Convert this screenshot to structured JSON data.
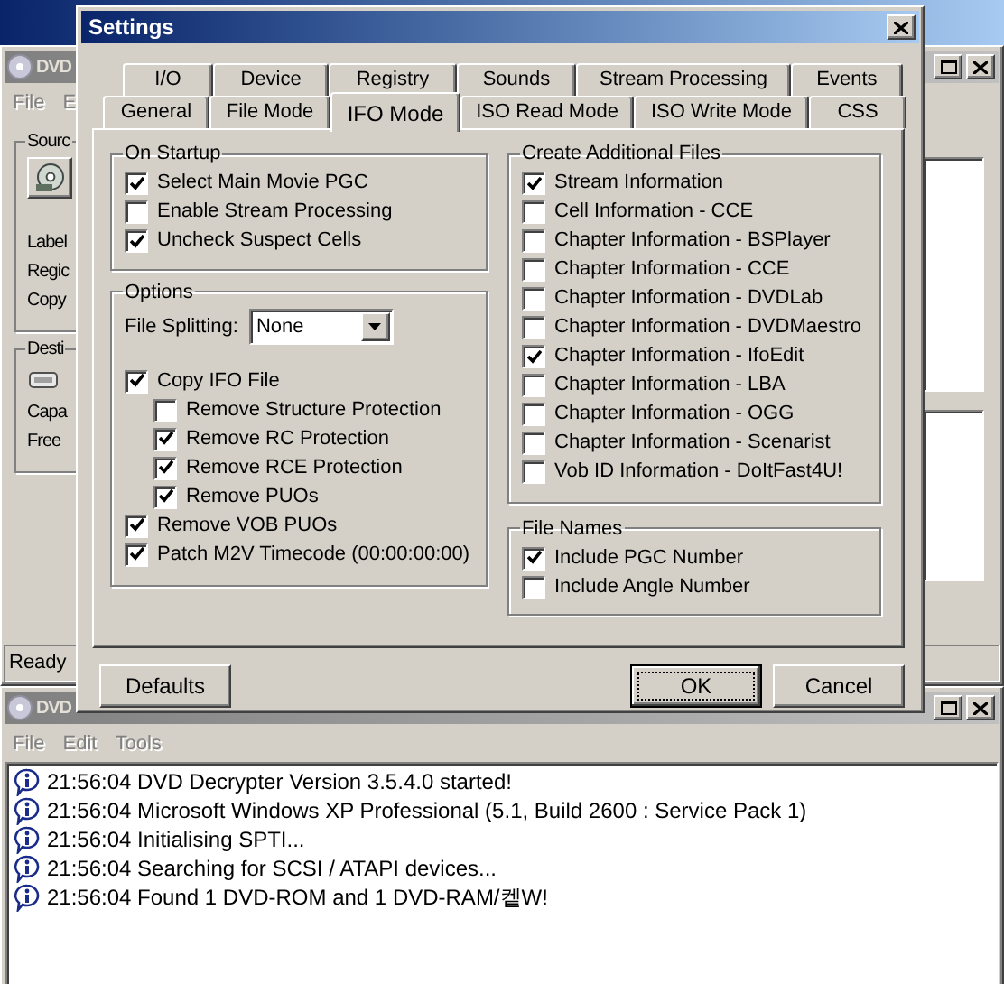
{
  "main_window": {
    "title": "DVD",
    "menu": [
      "File",
      "E"
    ],
    "source_group": {
      "title": "Sourc",
      "rows": [
        "Label",
        "Regic",
        "Copy"
      ]
    },
    "destination_group": {
      "title": "Desti",
      "rows": [
        "Capa",
        "Free"
      ]
    },
    "status_bar": "Ready"
  },
  "log_window": {
    "title": "DVD",
    "menu": [
      "File",
      "Edit",
      "Tools"
    ],
    "entries": [
      "21:56:04 DVD Decrypter Version 3.5.4.0 started!",
      "21:56:04 Microsoft Windows XP Professional (5.1, Build 2600 : Service Pack 1)",
      "21:56:04 Initialising SPTI...",
      "21:56:04 Searching for SCSI / ATAPI devices...",
      "21:56:04 Found 1 DVD-ROM and 1 DVD-RAM/켙W!"
    ]
  },
  "settings": {
    "title": "Settings",
    "tab_rows": [
      [
        {
          "label": "I/O",
          "selected": false
        },
        {
          "label": "Device",
          "selected": false
        },
        {
          "label": "Registry",
          "selected": false
        },
        {
          "label": "Sounds",
          "selected": false
        },
        {
          "label": "Stream Processing",
          "selected": false
        },
        {
          "label": "Events",
          "selected": false
        }
      ],
      [
        {
          "label": "General",
          "selected": false
        },
        {
          "label": "File Mode",
          "selected": false
        },
        {
          "label": "IFO Mode",
          "selected": true
        },
        {
          "label": "ISO Read Mode",
          "selected": false
        },
        {
          "label": "ISO Write Mode",
          "selected": false
        },
        {
          "label": "CSS",
          "selected": false
        }
      ]
    ],
    "on_startup": {
      "title": "On Startup",
      "options": [
        {
          "label": "Select Main Movie PGC",
          "checked": true
        },
        {
          "label": "Enable Stream Processing",
          "checked": false
        },
        {
          "label": "Uncheck Suspect Cells",
          "checked": true
        }
      ]
    },
    "options": {
      "title": "Options",
      "file_splitting": {
        "label": "File Splitting:",
        "value": "None"
      },
      "items": [
        {
          "label": "Copy IFO File",
          "checked": true,
          "children": [
            {
              "label": "Remove Structure Protection",
              "checked": false
            },
            {
              "label": "Remove RC Protection",
              "checked": true
            },
            {
              "label": "Remove RCE Protection",
              "checked": true
            },
            {
              "label": "Remove PUOs",
              "checked": true
            }
          ]
        },
        {
          "label": "Remove VOB PUOs",
          "checked": true
        },
        {
          "label": "Patch M2V Timecode (00:00:00:00)",
          "checked": true
        }
      ]
    },
    "create_additional_files": {
      "title": "Create Additional Files",
      "options": [
        {
          "label": "Stream Information",
          "checked": true
        },
        {
          "label": "Cell Information - CCE",
          "checked": false
        },
        {
          "label": "Chapter Information - BSPlayer",
          "checked": false
        },
        {
          "label": "Chapter Information - CCE",
          "checked": false
        },
        {
          "label": "Chapter Information - DVDLab",
          "checked": false
        },
        {
          "label": "Chapter Information - DVDMaestro",
          "checked": false
        },
        {
          "label": "Chapter Information - IfoEdit",
          "checked": true
        },
        {
          "label": "Chapter Information - LBA",
          "checked": false
        },
        {
          "label": "Chapter Information - OGG",
          "checked": false
        },
        {
          "label": "Chapter Information - Scenarist",
          "checked": false
        },
        {
          "label": "Vob ID Information - DoItFast4U!",
          "checked": false
        }
      ]
    },
    "file_names": {
      "title": "File Names",
      "options": [
        {
          "label": "Include PGC Number",
          "checked": true
        },
        {
          "label": "Include Angle Number",
          "checked": false
        }
      ]
    },
    "buttons": [
      {
        "label": "Defaults",
        "focused": false
      },
      {
        "label": "OK",
        "focused": true
      },
      {
        "label": "Cancel",
        "focused": false
      }
    ]
  }
}
